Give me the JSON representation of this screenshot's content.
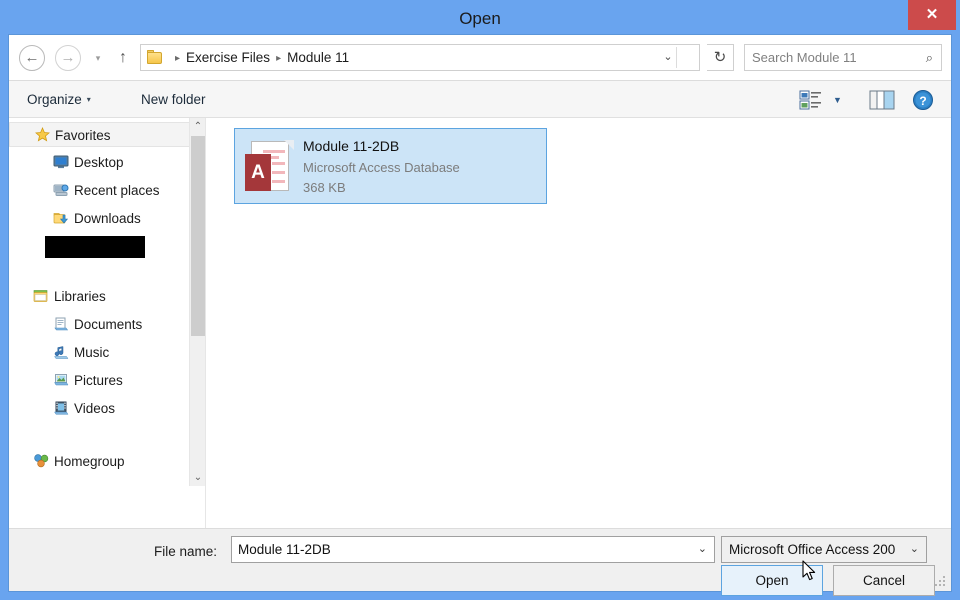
{
  "window": {
    "title": "Open",
    "close_label": "✕",
    "frame_color": "#69a4ef",
    "close_color": "#cc4b4b"
  },
  "navbar": {
    "back_icon": "←",
    "forward_icon": "→",
    "history_icon": "▾",
    "up_icon": "↑",
    "breadcrumb": {
      "folder_icon": "folder-icon",
      "items": [
        "Exercise Files",
        "Module 11"
      ],
      "separator": "▸",
      "dropdown_icon": "⌄"
    },
    "refresh_icon": "↻",
    "search": {
      "placeholder": "Search Module 11",
      "icon": "⌕"
    }
  },
  "toolbar": {
    "organize_label": "Organize",
    "organize_caret": "▾",
    "new_folder_label": "New folder",
    "view_icon": "view-mode-icon",
    "view_caret": "▼",
    "preview_pane_icon": "preview-pane-icon",
    "help_icon": "?"
  },
  "sidebar": {
    "items": [
      {
        "label": "Favorites",
        "level": 0,
        "icon": "star-icon",
        "selected": true,
        "redacted": false
      },
      {
        "label": "Desktop",
        "level": 1,
        "icon": "monitor-icon",
        "selected": false,
        "redacted": false
      },
      {
        "label": "Recent places",
        "level": 1,
        "icon": "recent-icon",
        "selected": false,
        "redacted": false
      },
      {
        "label": "Downloads",
        "level": 1,
        "icon": "downloads-icon",
        "selected": false,
        "redacted": false
      },
      {
        "label": "",
        "level": 1,
        "icon": "",
        "selected": false,
        "redacted": true
      },
      {
        "label": "Libraries",
        "level": 0,
        "icon": "libraries-icon",
        "selected": false,
        "redacted": false
      },
      {
        "label": "Documents",
        "level": 1,
        "icon": "documents-icon",
        "selected": false,
        "redacted": false
      },
      {
        "label": "Music",
        "level": 1,
        "icon": "music-icon",
        "selected": false,
        "redacted": false
      },
      {
        "label": "Pictures",
        "level": 1,
        "icon": "pictures-icon",
        "selected": false,
        "redacted": false
      },
      {
        "label": "Videos",
        "level": 1,
        "icon": "videos-icon",
        "selected": false,
        "redacted": false
      },
      {
        "label": "Homegroup",
        "level": 0,
        "icon": "homegroup-icon",
        "selected": false,
        "redacted": false
      }
    ],
    "scroll_up_icon": "⌃",
    "scroll_down_icon": "⌄"
  },
  "files": [
    {
      "name": "Module 11-2DB",
      "type": "Microsoft Access Database",
      "size": "368 KB",
      "icon": "access-database-icon",
      "icon_letter": "A",
      "selected": true
    }
  ],
  "footer": {
    "file_name_label": "File name:",
    "file_name_value": "Module 11-2DB",
    "file_name_chevron": "⌄",
    "file_type_value": "Microsoft Office Access 200",
    "file_type_chevron": "⌄",
    "open_label": "Open",
    "cancel_label": "Cancel"
  }
}
